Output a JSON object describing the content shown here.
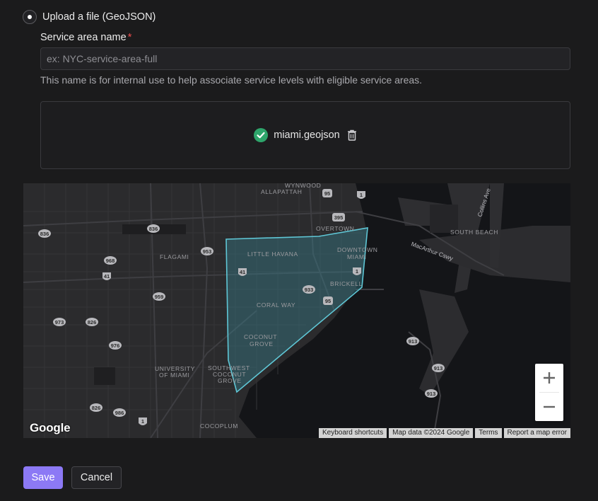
{
  "form": {
    "radio_option_label": "Upload a file (GeoJSON)",
    "service_area_label": "Service area name",
    "required_marker": "*",
    "name_input": {
      "value": "",
      "placeholder": "ex: NYC-service-area-full"
    },
    "helper_text": "This name is for internal use to help associate service levels with eligible service areas.",
    "uploaded_file": "miami.geojson"
  },
  "map": {
    "logo": "Google",
    "attribution": [
      "Keyboard shortcuts",
      "Map data ©2024 Google",
      "Terms",
      "Report a map error"
    ],
    "zoom_in_label": "+",
    "zoom_out_label": "−",
    "neighborhoods": [
      "ALLAPATTAH",
      "OVERTOWN",
      "DOWNTOWN",
      "MIAMI",
      "SOUTH BEACH",
      "FLAGAMI",
      "LITTLE HAVANA",
      "BRICKELL",
      "CORAL WAY",
      "COCONUT",
      "GROVE",
      "UNIVERSITY",
      "OF MIAMI",
      "SOUTHWEST",
      "COCONUT",
      "GROVE",
      "COCOPLUM",
      "WYNWOOD"
    ],
    "roads": [
      "MacArthur Cswy",
      "Collins Ave"
    ],
    "shields": [
      "95",
      "1",
      "395",
      "836",
      "836",
      "953",
      "968",
      "41",
      "41",
      "933",
      "1",
      "95",
      "959",
      "973",
      "826",
      "976",
      "913",
      "913",
      "913",
      "826",
      "986",
      "1"
    ],
    "colors": {
      "polygon_stroke": "#5fc7d6",
      "polygon_fill": "#3a8a98"
    }
  },
  "actions": {
    "save_label": "Save",
    "cancel_label": "Cancel"
  },
  "colors": {
    "accent": "#8c79f5",
    "success": "#2ea56b",
    "required": "#ef4d4d"
  }
}
